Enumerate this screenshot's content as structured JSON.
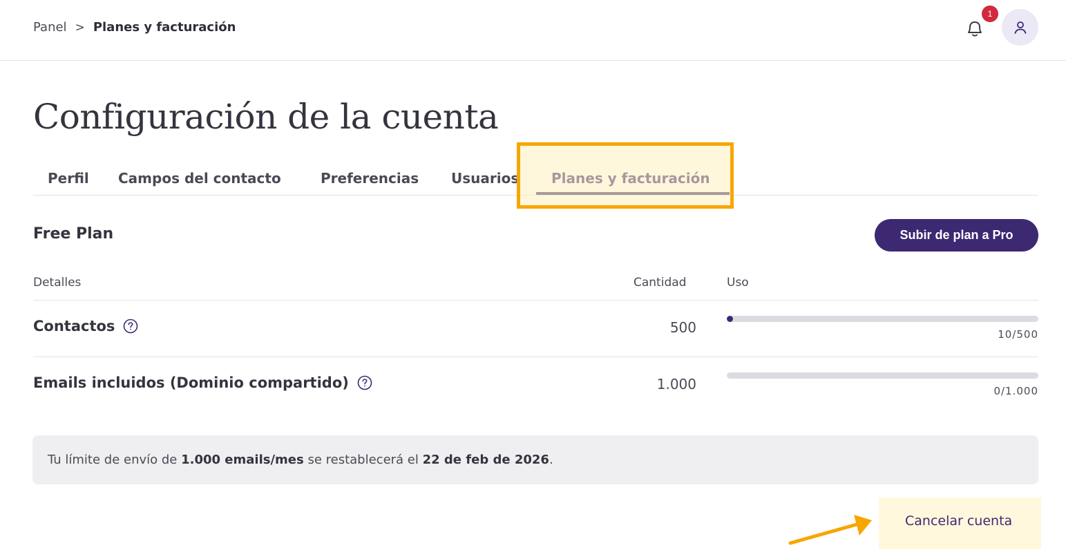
{
  "breadcrumb": {
    "root": "Panel",
    "separator": ">",
    "current": "Planes y facturación"
  },
  "notifications": {
    "count": "1"
  },
  "page": {
    "title": "Configuración de la cuenta"
  },
  "tabs": [
    {
      "label": "Perfil",
      "active": false
    },
    {
      "label": "Campos del contacto",
      "active": false
    },
    {
      "label": "Preferencias",
      "active": false
    },
    {
      "label": "Usuarios",
      "active": false
    },
    {
      "label": "Planes y facturación",
      "active": true
    }
  ],
  "plan": {
    "name": "Free Plan",
    "upgrade_label": "Subir de plan a Pro"
  },
  "table": {
    "headers": {
      "details": "Detalles",
      "quantity": "Cantidad",
      "usage": "Uso"
    },
    "rows": [
      {
        "label": "Contactos",
        "quantity": "500",
        "usage_text": "10/500",
        "usage_fraction": 0.02
      },
      {
        "label": "Emails incluidos (Dominio compartido)",
        "quantity": "1.000",
        "usage_text": "0/1.000",
        "usage_fraction": 0
      }
    ]
  },
  "notice": {
    "prefix": "Tu límite de envío de ",
    "limit": "1.000 emails/mes",
    "middle": " se restablecerá el ",
    "date": "22 de feb de 2026",
    "suffix": "."
  },
  "cancel": {
    "label": "Cancelar cuenta"
  },
  "colors": {
    "accent": "#3d2872",
    "highlight": "#f7a600",
    "badge": "#d1293d"
  }
}
